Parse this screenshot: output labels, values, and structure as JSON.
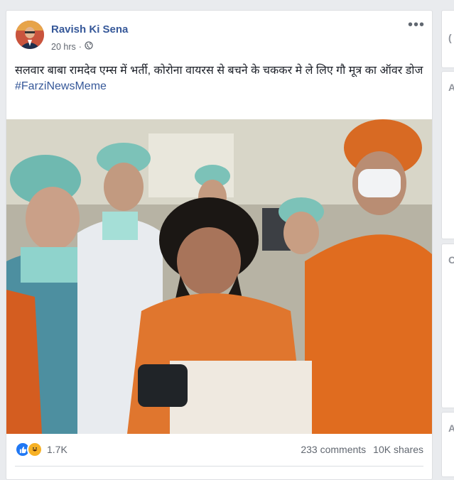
{
  "post": {
    "author": "Ravish Ki Sena",
    "time": "20 hrs",
    "privacy_icon": "globe-icon",
    "more_label": "•••",
    "text": "सलवार बाबा रामदेव एम्स में भर्ती, कोरोना वायरस से बचने के चककर मे ले लिए गौ मूत्र का ऑवर डोज",
    "hashtag": "#FarziNewsMeme",
    "reactions": {
      "icons": [
        "like-icon",
        "haha-icon"
      ],
      "count": "1.7K"
    },
    "comments": "233 comments",
    "shares": "10K shares"
  },
  "sidebar": {
    "cards": [
      {
        "letter": "("
      },
      {
        "letter": "A"
      },
      {
        "letter": "C"
      },
      {
        "letter": "A"
      }
    ]
  },
  "colors": {
    "link": "#365899",
    "like": "#2078f4",
    "haha": "#f7b125",
    "background": "#e9ebee"
  }
}
